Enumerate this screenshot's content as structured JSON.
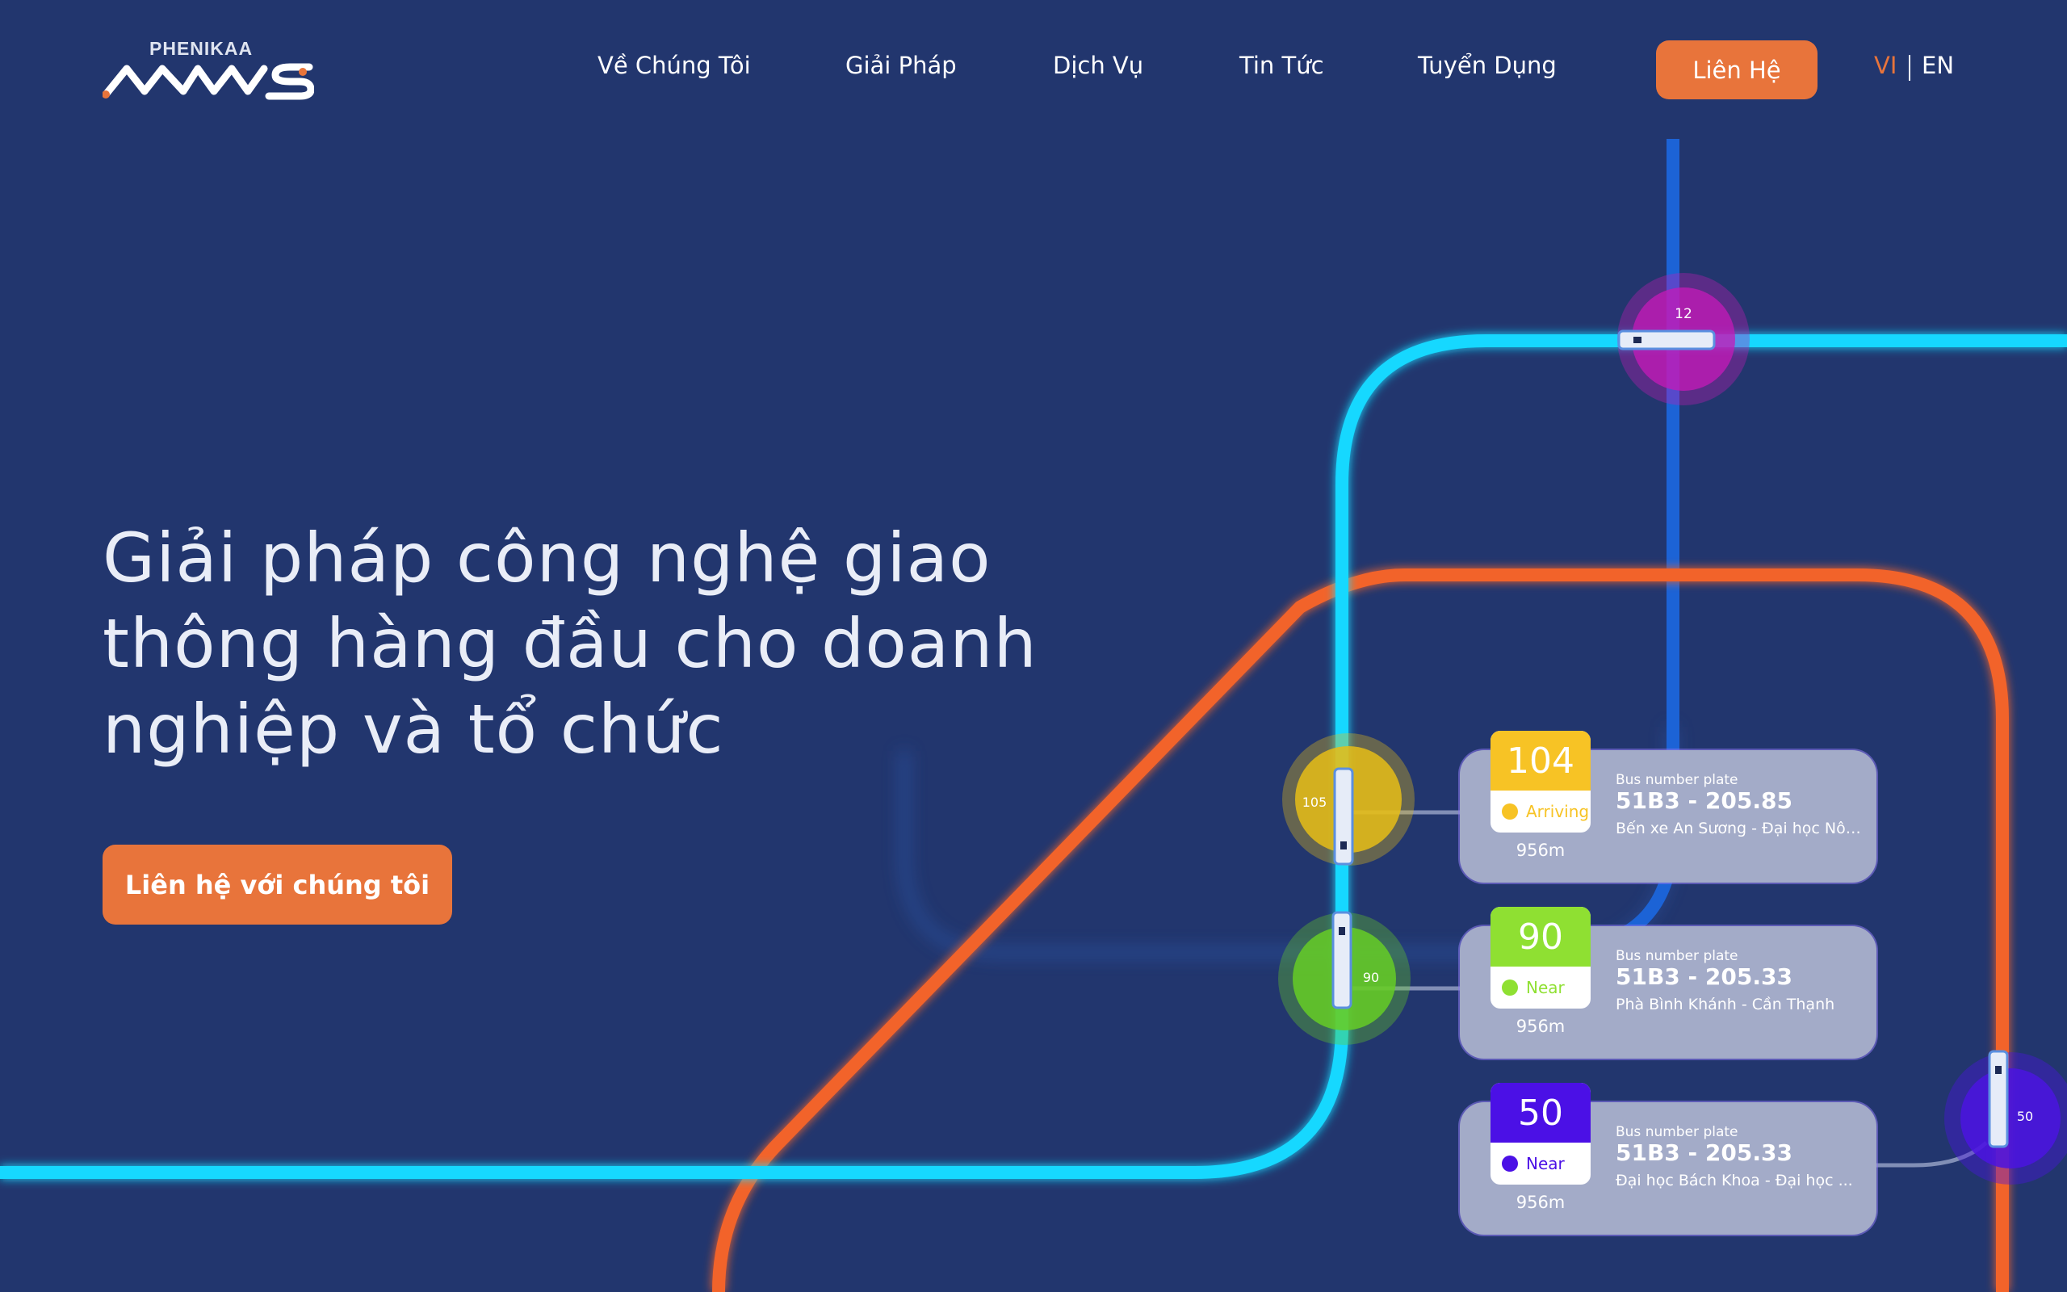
{
  "brand": {
    "top": "PHENIKAA",
    "bottom": "MAAS"
  },
  "nav": {
    "items": [
      {
        "label": "Về Chúng Tôi"
      },
      {
        "label": "Giải Pháp"
      },
      {
        "label": "Dịch Vụ"
      },
      {
        "label": "Tin Tức"
      },
      {
        "label": "Tuyển Dụng"
      }
    ],
    "contact": "Liên Hệ",
    "lang": {
      "vi": "VI",
      "en": "EN",
      "active": "VI"
    }
  },
  "hero": {
    "title_lines": [
      "Giải pháp công nghệ giao",
      "thông hàng đầu cho doanh",
      "nghiệp và tổ chức"
    ],
    "cta": "Liên hệ với chúng tôi"
  },
  "markers": [
    {
      "label": "12",
      "color": "#c51ab8"
    },
    {
      "label": "105",
      "color": "#e6bd16"
    },
    {
      "label": "90",
      "color": "#66cc26"
    },
    {
      "label": "50",
      "color": "#4b14e0"
    }
  ],
  "cards": [
    {
      "number": "104",
      "color": "#f7c325",
      "status": "Arriving",
      "distance": "956m",
      "plate_label": "Bus number plate",
      "plate": "51B3 - 205.85",
      "route": "Bến xe An Sương - Đại học Nông ..."
    },
    {
      "number": "90",
      "color": "#8fe032",
      "status": "Near",
      "distance": "956m",
      "plate_label": "Bus number plate",
      "plate": "51B3 - 205.33",
      "route": "Phà Bình Khánh - Cần Thạnh"
    },
    {
      "number": "50",
      "color": "#4b10e6",
      "status": "Near",
      "distance": "956m",
      "plate_label": "Bus number plate",
      "plate": "51B3 - 205.33",
      "route": "Đại học Bách Khoa - Đại học ..."
    }
  ],
  "colors": {
    "background": "#22366e",
    "accent": "#e8743b",
    "cyan_line": "#14d8ff",
    "orange_line": "#f2642a",
    "blue_line": "#1c63d6"
  }
}
